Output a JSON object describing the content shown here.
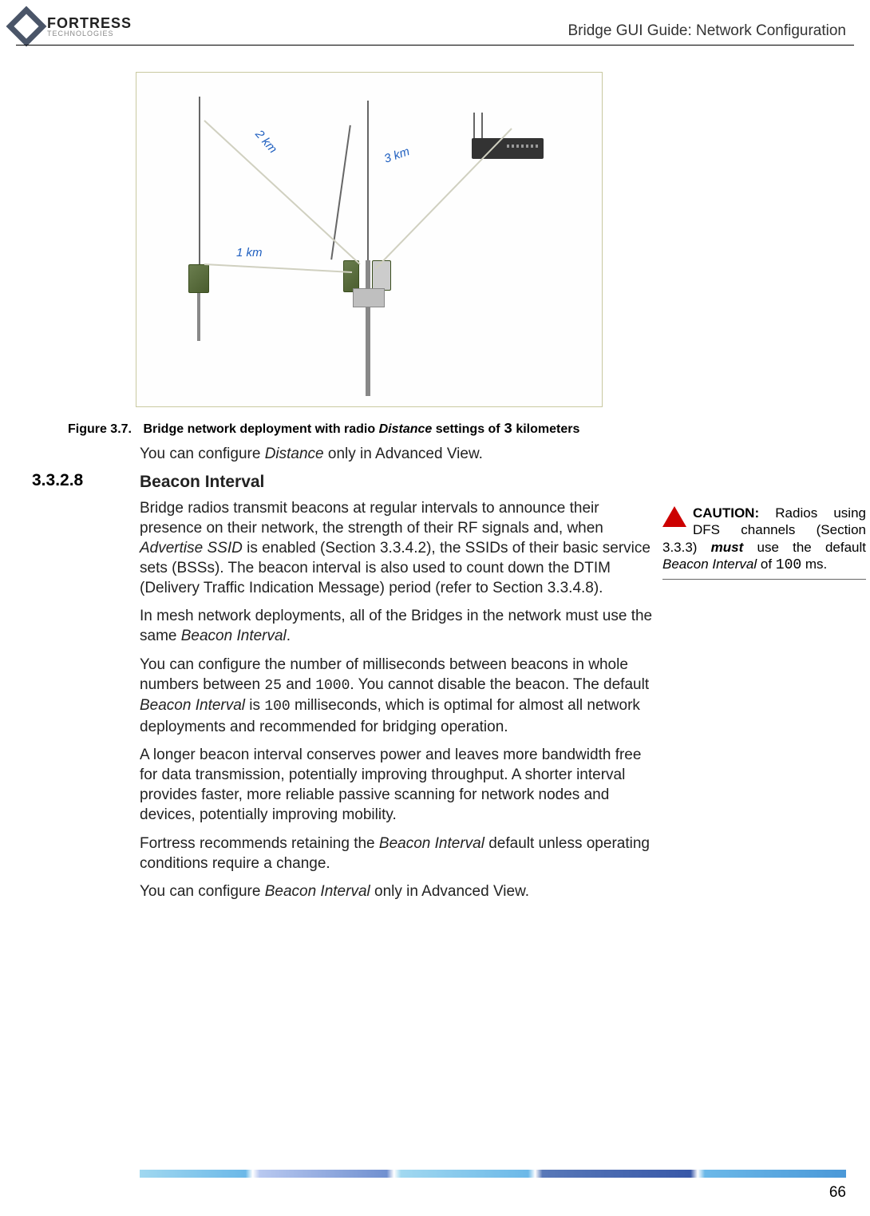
{
  "header": {
    "logo_main": "FORTRESS",
    "logo_sub": "TECHNOLOGIES",
    "guide_title": "Bridge GUI Guide: Network Configuration"
  },
  "figure": {
    "labels": {
      "d1": "1 km",
      "d2": "2 km",
      "d3": "3 km"
    },
    "caption_num": "Figure 3.7.",
    "caption_text_prefix": "Bridge network deployment with radio ",
    "caption_italic": "Distance",
    "caption_text_suffix": " settings of ",
    "caption_value": "3",
    "caption_text_end": " kilometers"
  },
  "section": {
    "num": "3.3.2.8",
    "title": "Beacon Interval"
  },
  "paragraphs": {
    "p0_a": "You can configure ",
    "p0_i": "Distance",
    "p0_b": " only in Advanced View.",
    "p1_a": "Bridge radios transmit beacons at regular intervals to announce their presence on their network, the strength of their RF signals and, when ",
    "p1_i": "Advertise SSID",
    "p1_b": " is enabled (Section 3.3.4.2), the SSIDs of their basic service sets (BSSs). The beacon interval is also used to count down the DTIM (Delivery Traffic Indication Message) period (refer to Section 3.3.4.8).",
    "p2_a": "In mesh network deployments, all of the Bridges in the network must use the same ",
    "p2_i": "Beacon Interval",
    "p2_b": ".",
    "p3_a": "You can configure the number of milliseconds between beacons in whole numbers between ",
    "p3_m1": "25",
    "p3_b": " and ",
    "p3_m2": "1000",
    "p3_c": ". You cannot disable the beacon. The default ",
    "p3_i": "Beacon Interval",
    "p3_d": " is ",
    "p3_m3": "100",
    "p3_e": " milliseconds, which is optimal for almost all network deployments and recommended for bridging operation.",
    "p4": "A longer beacon interval conserves power and leaves more bandwidth free for data transmission, potentially improving throughput. A shorter interval provides faster, more reliable passive scanning for network nodes and devices, potentially improving mobility.",
    "p5_a": "Fortress recommends retaining the ",
    "p5_i": "Beacon Interval",
    "p5_b": " default unless operating conditions require a change.",
    "p6_a": "You can configure ",
    "p6_i": "Beacon Interval",
    "p6_b": " only in Advanced View."
  },
  "caution": {
    "label": "CAUTION:",
    "text_a": " Radios using DFS channels (Section 3.3.3) ",
    "bold": "must",
    "text_b": " use the default ",
    "italic": "Beacon Interval",
    "text_c": " of ",
    "mono": "100",
    "text_d": " ms."
  },
  "page_number": "66"
}
